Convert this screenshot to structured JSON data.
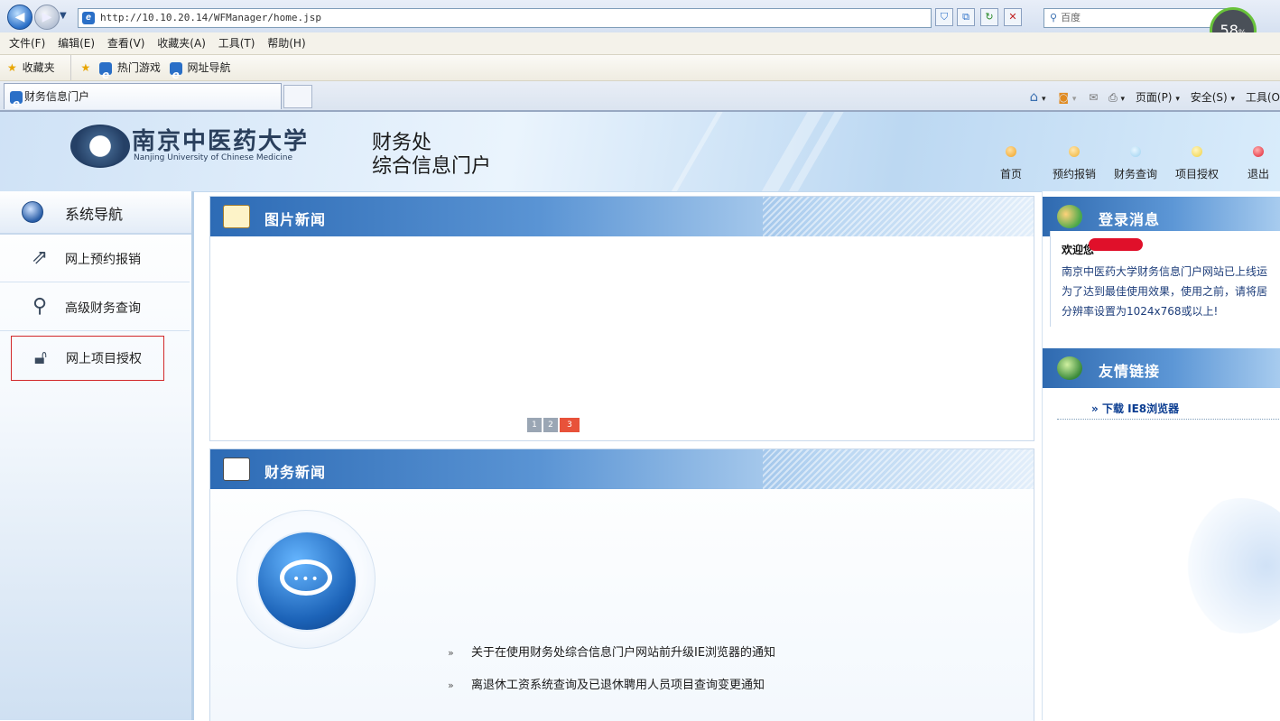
{
  "browser": {
    "url": "http://10.10.20.14/WFManager/home.jsp",
    "search_placeholder": "百度",
    "progress_badge": "58",
    "progress_unit": "%",
    "menu": [
      "文件(F)",
      "编辑(E)",
      "查看(V)",
      "收藏夹(A)",
      "工具(T)",
      "帮助(H)"
    ],
    "favorites": {
      "label": "收藏夹",
      "items": [
        "热门游戏",
        "网址导航"
      ]
    },
    "tab_title": "财务信息门户",
    "command_bar": {
      "page": "页面(P)",
      "safety": "安全(S)",
      "tools": "工具(O"
    }
  },
  "header": {
    "university_cn": "南京中医药大学",
    "university_en": "Nanjing University of Chinese Medicine",
    "portal_line1": "财务处",
    "portal_line2": "综合信息门户",
    "nav": [
      {
        "label": "首页",
        "color": "#f0a020"
      },
      {
        "label": "预约报销",
        "color": "#f0b030"
      },
      {
        "label": "财务查询",
        "color": "#9ad0f0"
      },
      {
        "label": "项目授权",
        "color": "#f0d040"
      },
      {
        "label": "退出",
        "color": "#e02030"
      }
    ]
  },
  "sidebar": {
    "title": "系统导航",
    "items": [
      {
        "label": "网上预约报销",
        "icon": "share-arrow-icon"
      },
      {
        "label": "高级财务查询",
        "icon": "magnifier-icon"
      },
      {
        "label": "网上项目授权",
        "icon": "unlock-icon"
      }
    ]
  },
  "photo_news": {
    "title": "图片新闻",
    "pages": [
      "1",
      "2",
      "3"
    ],
    "active_page": "3"
  },
  "finance_news": {
    "title": "财务新闻",
    "items": [
      "关于在使用财务处综合信息门户网站前升级IE浏览器的通知",
      "离退休工资系统查询及已退休聘用人员项目查询变更通知"
    ]
  },
  "login_panel": {
    "title": "登录消息",
    "welcome": "欢迎您",
    "lines": [
      "南京中医药大学财务信息门户网站已上线运",
      "为了达到最佳使用效果，使用之前，请将居",
      "分辨率设置为1024x768或以上!"
    ]
  },
  "links_panel": {
    "title": "友情链接",
    "items": [
      "下载 IE8浏览器"
    ]
  },
  "colors": {
    "accent_blue": "#2d6bb5",
    "sidebar_highlight_border": "#d2282a",
    "pager_active": "#e8523a"
  }
}
